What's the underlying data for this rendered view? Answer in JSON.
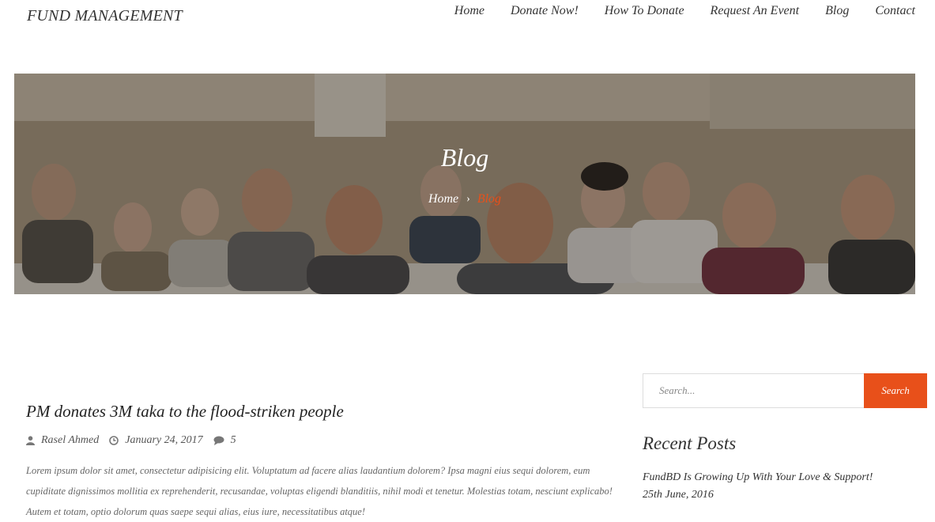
{
  "header": {
    "brand": "FUND MANAGEMENT",
    "nav": [
      "Home",
      "Donate Now!",
      "How To Donate",
      "Request An Event",
      "Blog",
      "Contact"
    ]
  },
  "hero": {
    "title": "Blog",
    "breadcrumb": {
      "home": "Home",
      "separator": "›",
      "current": "Blog"
    },
    "image_icon": "audience-photo"
  },
  "post": {
    "title": "PM donates 3M taka to the flood-striken people",
    "author": "Rasel Ahmed",
    "date": "January 24, 2017",
    "comments": "5",
    "excerpt": "Lorem ipsum dolor sit amet, consectetur adipisicing elit. Voluptatum ad facere alias laudantium dolorem? Ipsa magni eius sequi dolorem, eum cupiditate dignissimos mollitia ex reprehenderit, recusandae, voluptas eligendi blanditiis, nihil modi et tenetur. Molestias totam, nesciunt explicabo! Autem et totam, optio dolorum quas saepe sequi alias, eius iure, necessitatibus atque!"
  },
  "sidebar": {
    "search_placeholder": "Search...",
    "search_button": "Search",
    "recent_title": "Recent Posts",
    "recent": [
      {
        "title": "FundBD Is Growing Up With Your Love & Support!",
        "date": "25th June, 2016"
      }
    ]
  },
  "colors": {
    "accent": "#e8501a",
    "text": "#333333"
  }
}
